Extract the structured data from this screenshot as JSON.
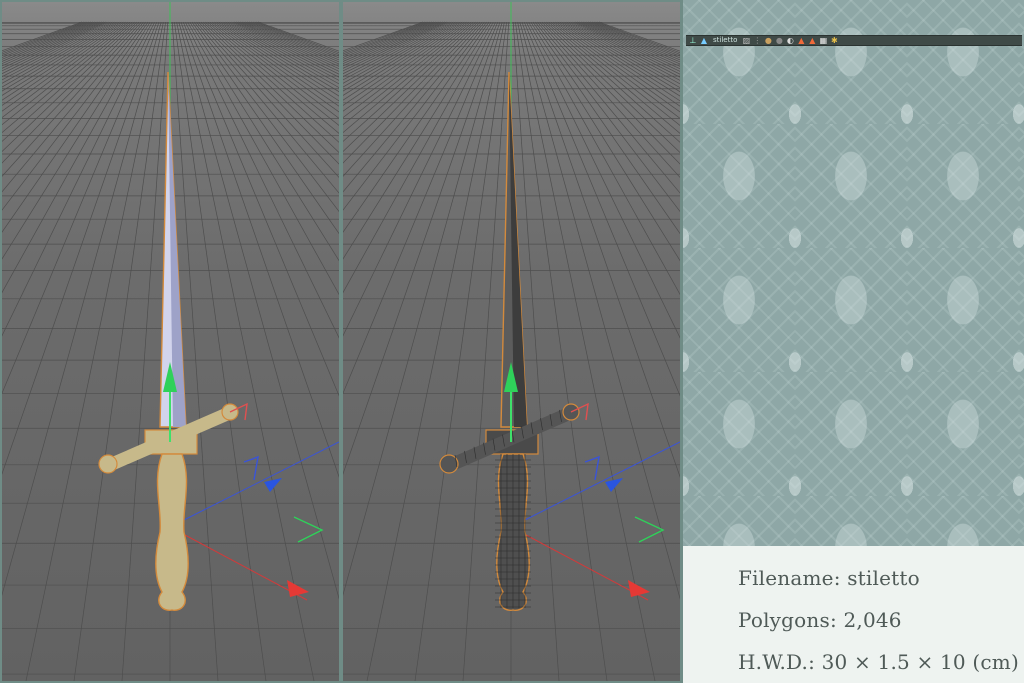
{
  "viewports": [
    {
      "id": "left",
      "shading": "solid"
    },
    {
      "id": "right",
      "shading": "wireframe"
    }
  ],
  "object_manager": {
    "object_name": "stiletto",
    "icons": [
      "null-icon",
      "object-icon",
      "tag-icon",
      "material-sphere-icon",
      "material-sphere-icon",
      "material-half-icon",
      "phong-triangle-icon",
      "phong-triangle-icon",
      "texture-checker-icon",
      "star-icon"
    ]
  },
  "info": {
    "filename": "Filename: stiletto",
    "polygons": "Polygons: 2,046",
    "dims": "H.W.D.: 30 × 1.5 × 10 (cm)"
  },
  "colors": {
    "model_solid": "#c7b98a",
    "model_outline": "#d38a3c",
    "model_wire": "#565656",
    "axis_x": "#e53935",
    "axis_y": "#2fd15a",
    "axis_z": "#2a55e0"
  }
}
